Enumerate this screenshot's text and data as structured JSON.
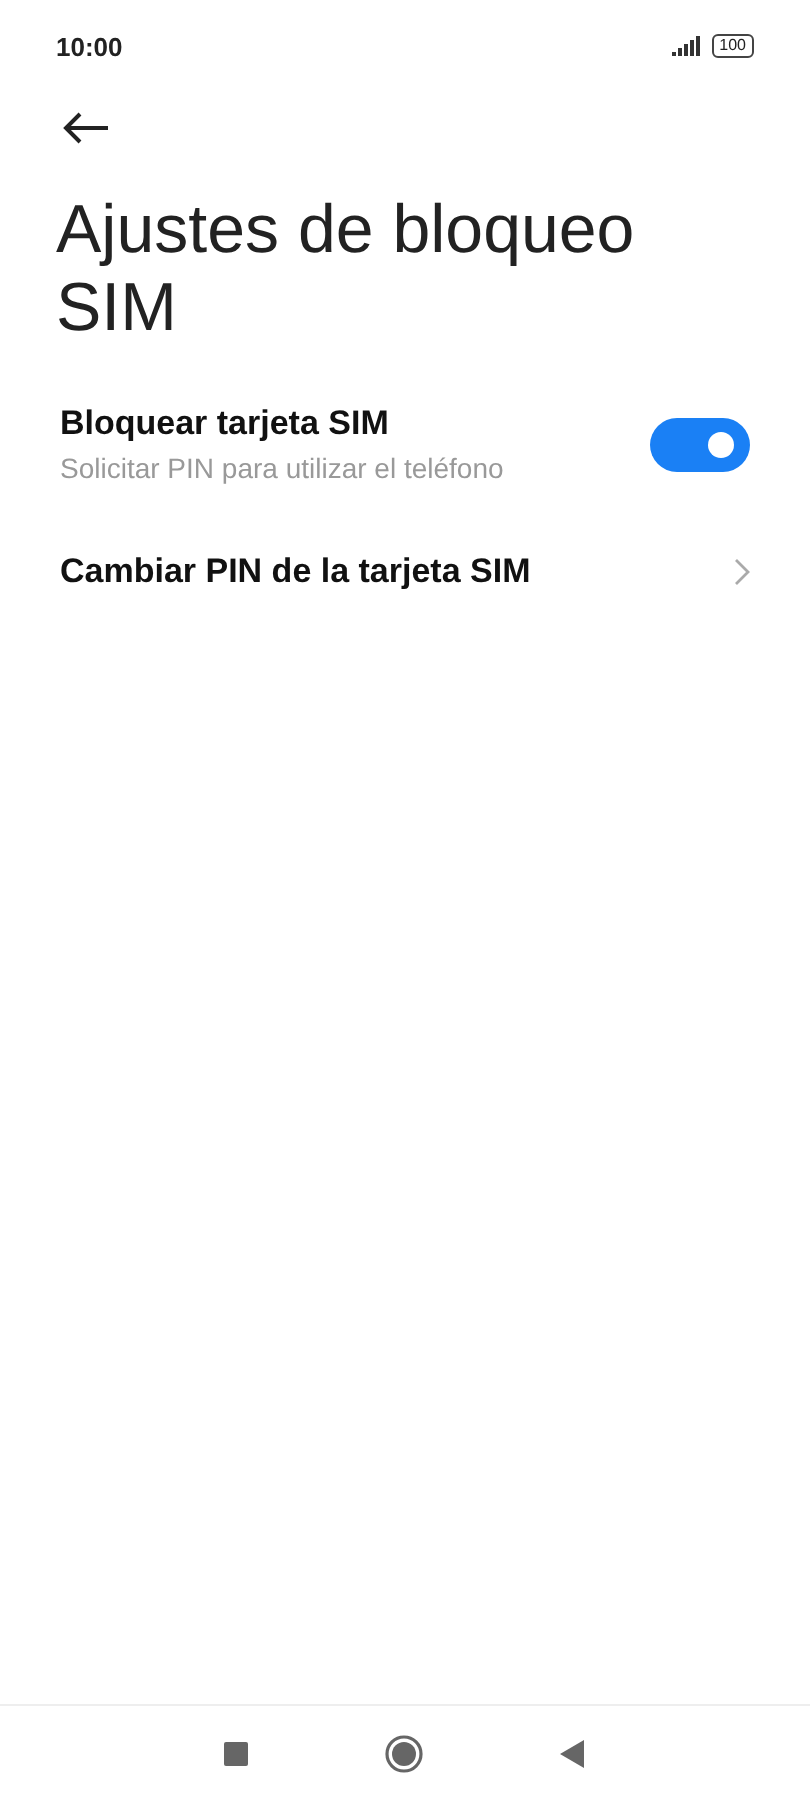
{
  "status_bar": {
    "time": "10:00",
    "battery": "100"
  },
  "title": "Ajustes de bloqueo SIM",
  "items": [
    {
      "kind": "toggle",
      "label": "Bloquear tarjeta SIM",
      "subtitle": "Solicitar PIN para utilizar el teléfono",
      "on": true
    },
    {
      "kind": "link",
      "label": "Cambiar PIN de la tarjeta SIM"
    }
  ]
}
